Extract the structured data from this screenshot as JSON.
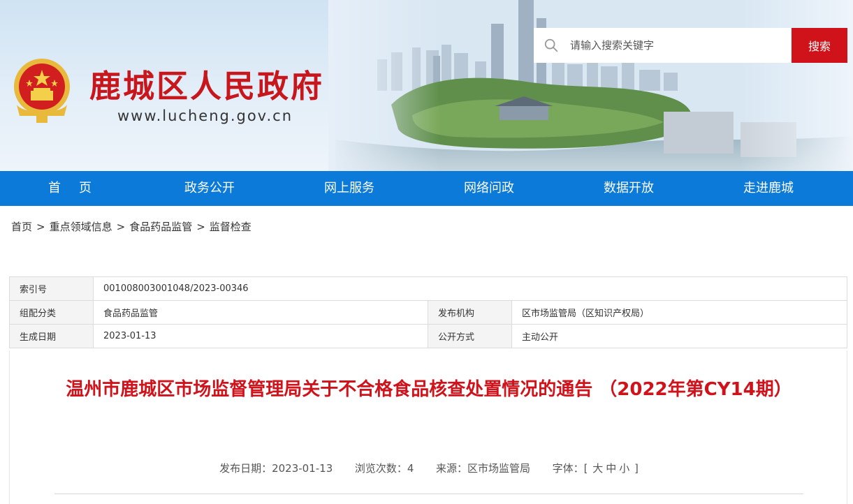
{
  "header": {
    "site_title": "鹿城区人民政府",
    "site_url": "www.lucheng.gov.cn",
    "search": {
      "placeholder": "请输入搜索关键字",
      "button_label": "搜索"
    },
    "brand_red": "#c8161d",
    "nav_blue": "#0b7ad8"
  },
  "nav": {
    "items": [
      {
        "label": "首页"
      },
      {
        "label": "政务公开"
      },
      {
        "label": "网上服务"
      },
      {
        "label": "网络问政"
      },
      {
        "label": "数据开放"
      },
      {
        "label": "走进鹿城"
      }
    ]
  },
  "breadcrumb": {
    "items": [
      "首页",
      "重点领域信息",
      "食品药品监管",
      "监督检查"
    ],
    "separator": ">"
  },
  "meta": {
    "index_label": "索引号",
    "index_value": "001008003001048/2023-00346",
    "category_label": "组配分类",
    "category_value": "食品药品监管",
    "publisher_label": "发布机构",
    "publisher_value": "区市场监管局（区知识产权局）",
    "created_label": "生成日期",
    "created_value": "2023-01-13",
    "public_label": "公开方式",
    "public_value": "主动公开"
  },
  "article": {
    "title": "温州市鹿城区市场监督管理局关于不合格食品核查处置情况的通告 （2022年第CY14期）",
    "publish_date_label": "发布日期：",
    "publish_date": "2023-01-13",
    "views_label": "浏览次数：",
    "views": "4",
    "source_label": "来源：",
    "source": "区市场监管局",
    "font_label": "字体：",
    "font_open": "[",
    "font_large": "大",
    "font_medium": "中",
    "font_small": "小",
    "font_close": "]"
  }
}
